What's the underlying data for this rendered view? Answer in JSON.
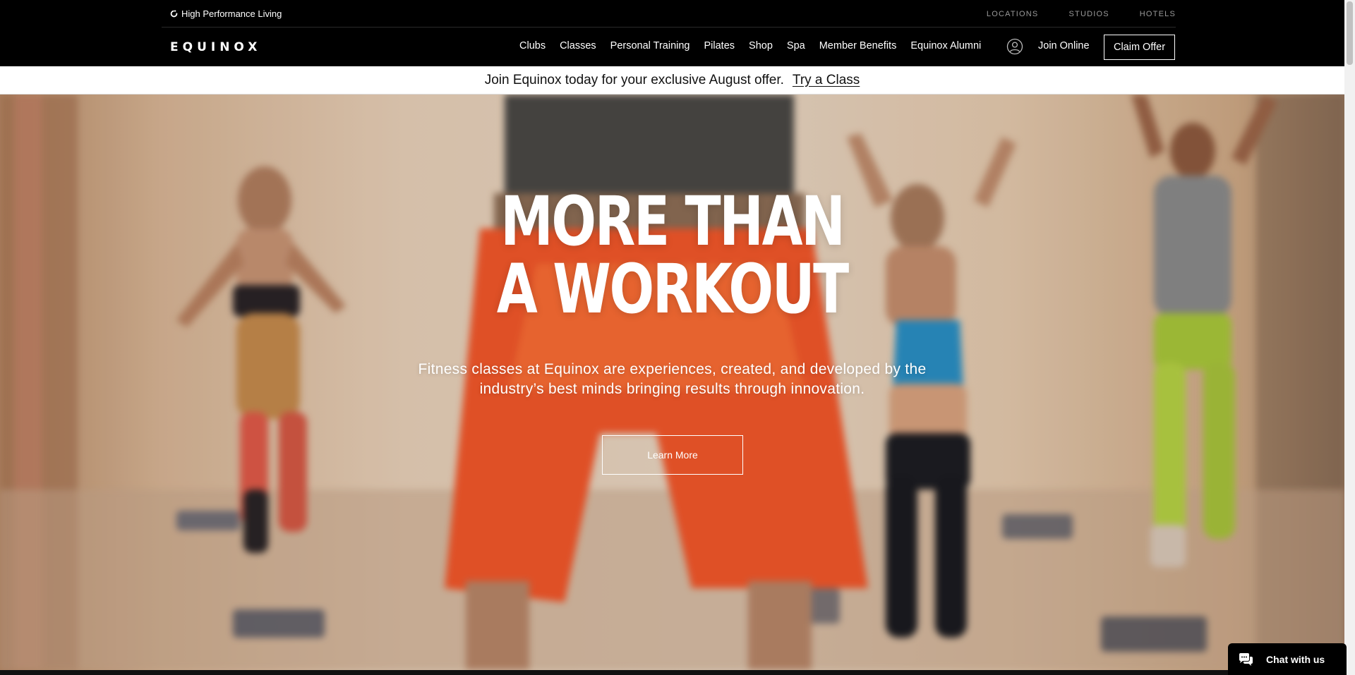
{
  "utility": {
    "tagline": "High Performance Living",
    "links": [
      "LOCATIONS",
      "STUDIOS",
      "HOTELS"
    ]
  },
  "nav": {
    "logo": "EQUINOX",
    "links": [
      "Clubs",
      "Classes",
      "Personal Training",
      "Pilates",
      "Shop",
      "Spa",
      "Member Benefits",
      "Equinox Alumni"
    ],
    "account_icon": "user-circle-icon",
    "join_online": "Join Online",
    "claim_offer": "Claim Offer"
  },
  "promo": {
    "text": "Join Equinox today for your exclusive August offer.",
    "link": "Try a Class"
  },
  "hero": {
    "title_line1": "MORE THAN",
    "title_line2": "A WORKOUT",
    "subtitle": "Fitness classes at Equinox are experiences, created, and developed by the industry’s best minds bringing results through innovation.",
    "button": "Learn More"
  },
  "chat": {
    "label": "Chat with us",
    "icon": "chat-bubbles-icon"
  },
  "colors": {
    "nav_bg": "#000000",
    "promo_bg": "#ffffff",
    "text_light": "#ffffff",
    "utility_link": "#9a9a9a"
  }
}
